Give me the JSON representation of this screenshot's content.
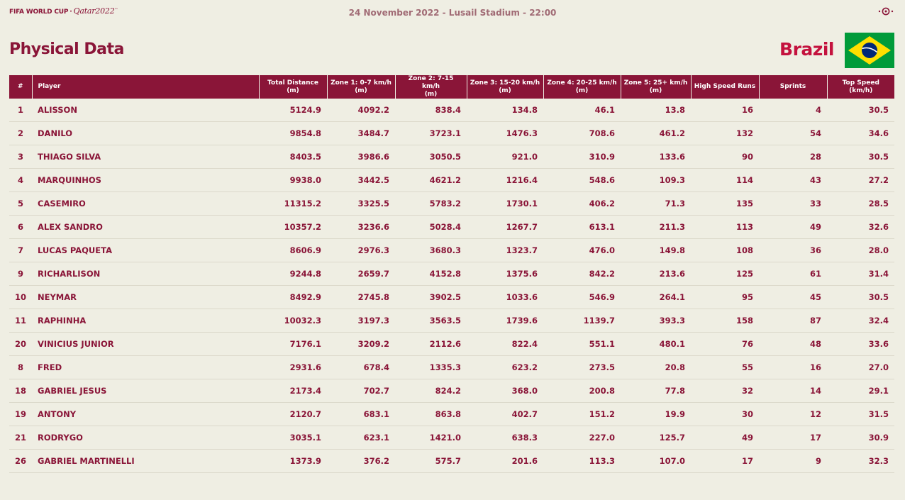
{
  "header": {
    "logo": {
      "brand": "FIFA WORLD CUP",
      "separator": "·",
      "event": "Qatar2022",
      "trademark": "™"
    },
    "match_info": "24 November 2022 - Lusail Stadium - 22:00"
  },
  "page_title": "Physical Data",
  "team_name": "Brazil",
  "colors": {
    "primary": "#8a1538",
    "team": "#c4123e",
    "background": "#efeee3"
  },
  "table": {
    "columns": [
      {
        "line1": "#",
        "line2": ""
      },
      {
        "line1": "Player",
        "line2": ""
      },
      {
        "line1": "Total Distance",
        "line2": "(m)"
      },
      {
        "line1": "Zone 1: 0-7 km/h",
        "line2": "(m)"
      },
      {
        "line1": "Zone 2: 7-15 km/h",
        "line2": "(m)"
      },
      {
        "line1": "Zone 3: 15-20 km/h",
        "line2": "(m)"
      },
      {
        "line1": "Zone 4: 20-25 km/h",
        "line2": "(m)"
      },
      {
        "line1": "Zone 5: 25+ km/h",
        "line2": "(m)"
      },
      {
        "line1": "High Speed Runs",
        "line2": ""
      },
      {
        "line1": "Sprints",
        "line2": ""
      },
      {
        "line1": "Top Speed",
        "line2": "(km/h)"
      }
    ],
    "rows": [
      [
        "1",
        "ALISSON",
        "5124.9",
        "4092.2",
        "838.4",
        "134.8",
        "46.1",
        "13.8",
        "16",
        "4",
        "30.5"
      ],
      [
        "2",
        "DANILO",
        "9854.8",
        "3484.7",
        "3723.1",
        "1476.3",
        "708.6",
        "461.2",
        "132",
        "54",
        "34.6"
      ],
      [
        "3",
        "THIAGO SILVA",
        "8403.5",
        "3986.6",
        "3050.5",
        "921.0",
        "310.9",
        "133.6",
        "90",
        "28",
        "30.5"
      ],
      [
        "4",
        "MARQUINHOS",
        "9938.0",
        "3442.5",
        "4621.2",
        "1216.4",
        "548.6",
        "109.3",
        "114",
        "43",
        "27.2"
      ],
      [
        "5",
        "CASEMIRO",
        "11315.2",
        "3325.5",
        "5783.2",
        "1730.1",
        "406.2",
        "71.3",
        "135",
        "33",
        "28.5"
      ],
      [
        "6",
        "ALEX SANDRO",
        "10357.2",
        "3236.6",
        "5028.4",
        "1267.7",
        "613.1",
        "211.3",
        "113",
        "49",
        "32.6"
      ],
      [
        "7",
        "LUCAS PAQUETA",
        "8606.9",
        "2976.3",
        "3680.3",
        "1323.7",
        "476.0",
        "149.8",
        "108",
        "36",
        "28.0"
      ],
      [
        "9",
        "RICHARLISON",
        "9244.8",
        "2659.7",
        "4152.8",
        "1375.6",
        "842.2",
        "213.6",
        "125",
        "61",
        "31.4"
      ],
      [
        "10",
        "NEYMAR",
        "8492.9",
        "2745.8",
        "3902.5",
        "1033.6",
        "546.9",
        "264.1",
        "95",
        "45",
        "30.5"
      ],
      [
        "11",
        "RAPHINHA",
        "10032.3",
        "3197.3",
        "3563.5",
        "1739.6",
        "1139.7",
        "393.3",
        "158",
        "87",
        "32.4"
      ],
      [
        "20",
        "VINICIUS JUNIOR",
        "7176.1",
        "3209.2",
        "2112.6",
        "822.4",
        "551.1",
        "480.1",
        "76",
        "48",
        "33.6"
      ],
      [
        "8",
        "FRED",
        "2931.6",
        "678.4",
        "1335.3",
        "623.2",
        "273.5",
        "20.8",
        "55",
        "16",
        "27.0"
      ],
      [
        "18",
        "GABRIEL JESUS",
        "2173.4",
        "702.7",
        "824.2",
        "368.0",
        "200.8",
        "77.8",
        "32",
        "14",
        "29.1"
      ],
      [
        "19",
        "ANTONY",
        "2120.7",
        "683.1",
        "863.8",
        "402.7",
        "151.2",
        "19.9",
        "30",
        "12",
        "31.5"
      ],
      [
        "21",
        "RODRYGO",
        "3035.1",
        "623.1",
        "1421.0",
        "638.3",
        "227.0",
        "125.7",
        "49",
        "17",
        "30.9"
      ],
      [
        "26",
        "GABRIEL MARTINELLI",
        "1373.9",
        "376.2",
        "575.7",
        "201.6",
        "113.3",
        "107.0",
        "17",
        "9",
        "32.3"
      ]
    ]
  }
}
